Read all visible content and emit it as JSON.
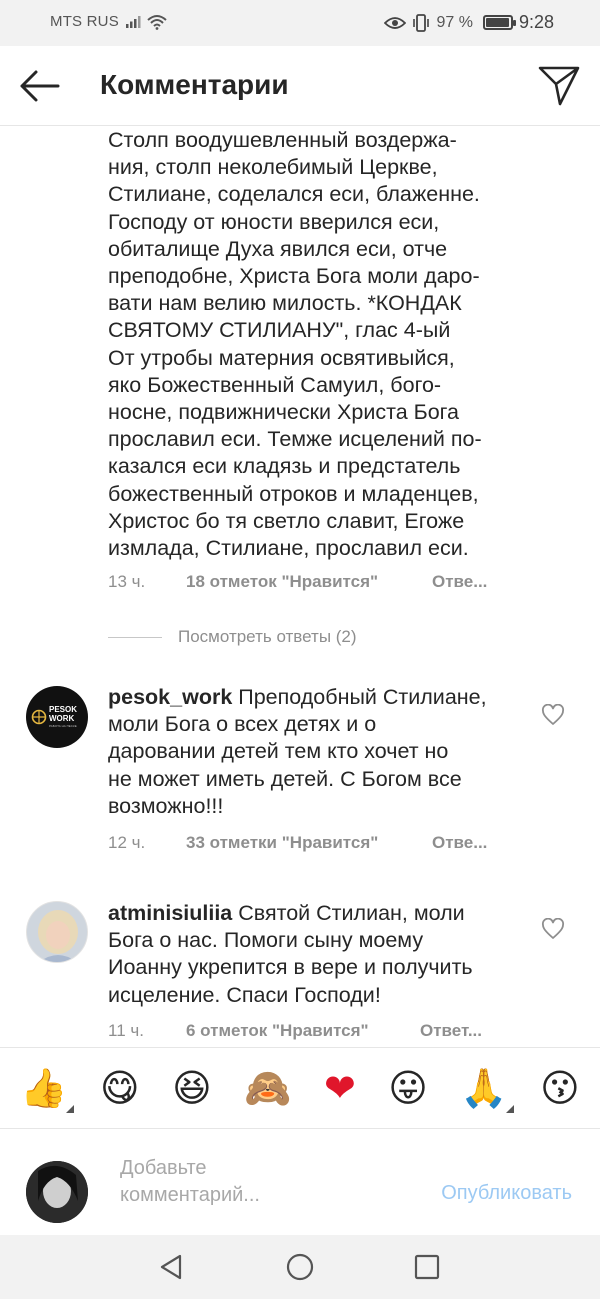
{
  "status_bar": {
    "carrier": "MTS RUS",
    "battery": "97 %",
    "battery_level": 0.97,
    "time": "9:28"
  },
  "header": {
    "title": "Комментарии",
    "back_icon": "arrow-left-icon",
    "send_icon": "paper-plane-icon"
  },
  "comments": [
    {
      "text": "Столп воодушевленный воздержа-\nния, столп неколебимый Церкве,\nСтилиане, соделался еси, блаженне.\nГосподу от юности вверился еси,\nобиталище Духа явился еси, отче\nпреподобне, Христа Бога моли даро-\nвати нам велию милость. *КОНДАК\nСВЯТОМУ СТИЛИАНУ\", глас 4-ый\nОт утробы матерния освятивыйся,\nяко Божественный Самуил, бого-\nносне, подвижнически Христа Бога\nпрославил еси. Темже исцелений по-\nказался еси кладязь и предстатель\nбожественный отроков и младенцев,\nХристос бо тя светло славит, Егоже\nизмлада, Стилиане, прославил еси.",
      "time": "13 ч.",
      "likes": "18 отметок \"Нравится\"",
      "reply": "Отве...",
      "view_replies": "Посмотреть ответы (2)"
    },
    {
      "username": "pesok_work",
      "text": " Преподобный Стилиане,\nмоли Бога о всех детях и о\nдаровании детей тем кто хочет но\nне может иметь детей. С Богом все\nвозможно!!!",
      "time": "12 ч.",
      "likes": "33 отметки \"Нравится\"",
      "reply": "Отве...",
      "avatar_text": "PESOK\nWORK",
      "avatar_subtext": "РАБОТА НА ПЕСКЕ"
    },
    {
      "username": "atminisiuliia",
      "text": " Святой Стилиан, моли\nБога о нас. Помоги сыну моему\nИоанну укрепится в вере и получить\nисцеление. Спаси Господи!",
      "time": "11 ч.",
      "likes": "6 отметок \"Нравится\"",
      "reply": "Ответ..."
    }
  ],
  "emoji_bar": [
    "👍",
    "😋",
    "😆",
    "🙈",
    "❤",
    "😛",
    "🙏",
    "😗"
  ],
  "composer": {
    "placeholder": "Добавьте\nкомментарий...",
    "publish": "Опубликовать"
  },
  "nav": {
    "back_icon": "triangle-back-icon",
    "home_icon": "circle-home-icon",
    "recents_icon": "square-recents-icon"
  },
  "colors": {
    "text": "#262626",
    "meta": "#8e8e8e",
    "publish_disabled": "#9cc9f3",
    "statusbar_bg": "#f2f2f2"
  }
}
